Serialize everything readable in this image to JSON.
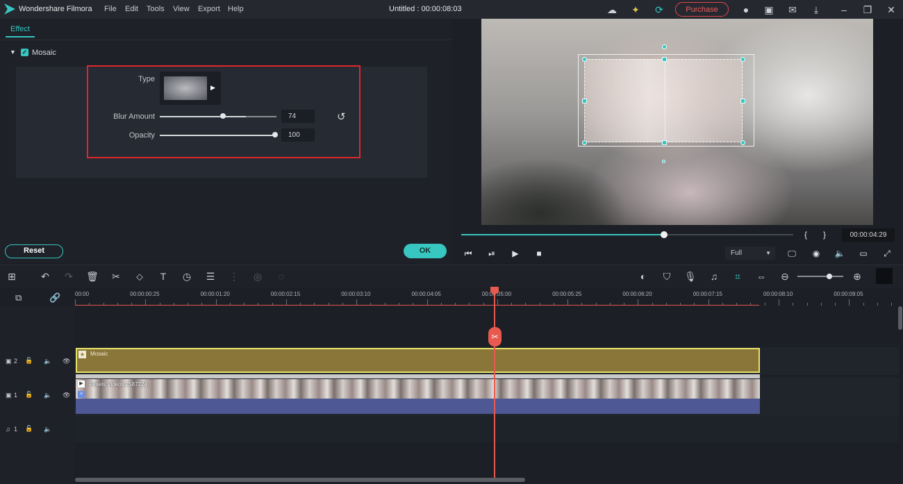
{
  "app": {
    "name": "Wondershare Filmora",
    "menu": [
      "File",
      "Edit",
      "Tools",
      "View",
      "Export",
      "Help"
    ],
    "doc_title": "Untitled : 00:00:08:03",
    "purchase_label": "Purchase"
  },
  "effect_panel": {
    "tab_label": "Effect",
    "effect_name": "Mosaic",
    "type_label": "Type",
    "blur_label": "Blur Amount",
    "blur_value": "74",
    "blur_fraction": 0.74,
    "opacity_label": "Opacity",
    "opacity_value": "100",
    "opacity_fraction": 1.0,
    "reset_label": "Reset",
    "ok_label": "OK"
  },
  "preview": {
    "progress_fraction": 0.61,
    "bracket_in": "{",
    "bracket_out": "}",
    "timecode": "00:00:04:29",
    "quality": "Full"
  },
  "timeline": {
    "ruler_labels": [
      "00:00",
      "00:00:00:25",
      "00:00:01:20",
      "00:00:02:15",
      "00:00:03:10",
      "00:00:04:05",
      "00:00:05:00",
      "00:00:05:25",
      "00:00:06:20",
      "00:00:07:15",
      "00:00:08:10",
      "00:00:09:05"
    ],
    "tracks": [
      {
        "id": "2",
        "clip_label": "Mosaic"
      },
      {
        "id": "1",
        "clip_label": "Pexels Videos 2587224"
      },
      {
        "id": "1",
        "clip_label": ""
      }
    ]
  },
  "colors": {
    "accent": "#37c6c0",
    "playhead": "#e85a4f",
    "highlight": "#e0272c",
    "effect_clip": "#8a7639",
    "audio_clip": "#4d5894"
  }
}
